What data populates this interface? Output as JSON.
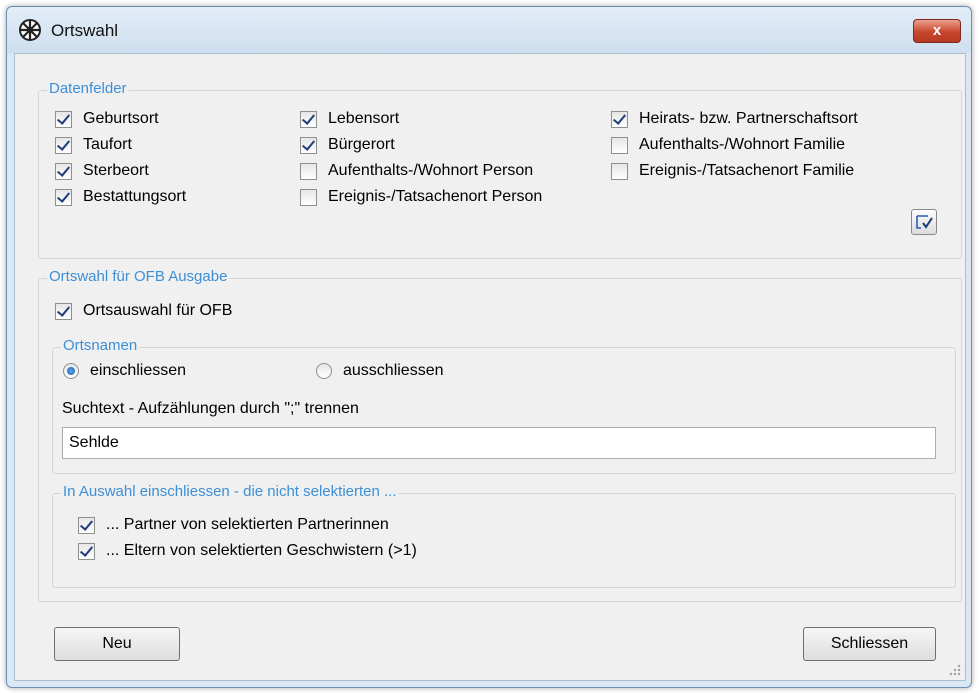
{
  "window": {
    "title": "Ortswahl",
    "close_label": "x"
  },
  "datenfelder": {
    "legend": "Datenfelder",
    "items": [
      {
        "label": "Geburtsort",
        "checked": true
      },
      {
        "label": "Taufort",
        "checked": true
      },
      {
        "label": "Sterbeort",
        "checked": true
      },
      {
        "label": "Bestattungsort",
        "checked": true
      },
      {
        "label": "Lebensort",
        "checked": true
      },
      {
        "label": "Bürgerort",
        "checked": true
      },
      {
        "label": "Aufenthalts-/Wohnort Person",
        "checked": false
      },
      {
        "label": "Ereignis-/Tatsachenort Person",
        "checked": false
      },
      {
        "label": "Heirats- bzw. Partnerschaftsort",
        "checked": true
      },
      {
        "label": "Aufenthalts-/Wohnort Familie",
        "checked": false
      },
      {
        "label": "Ereignis-/Tatsachenort Familie",
        "checked": false
      }
    ]
  },
  "ofb": {
    "legend": "Ortswahl für OFB Ausgabe",
    "ortsauswahl": {
      "label": "Ortsauswahl für OFB",
      "checked": true
    },
    "ortsnamen": {
      "legend": "Ortsnamen",
      "include_label": "einschliessen",
      "exclude_label": "ausschliessen",
      "selected": "einschliessen",
      "search_label": "Suchtext - Aufzählungen durch \";\" trennen",
      "search_value": "Sehlde"
    },
    "einschliessen": {
      "legend": "In Auswahl einschliessen - die nicht selektierten ...",
      "partner": {
        "label": "... Partner von selektierten Partnerinnen",
        "checked": true
      },
      "eltern": {
        "label": "... Eltern von selektierten Geschwistern (>1)",
        "checked": true
      }
    }
  },
  "buttons": {
    "neu": "Neu",
    "schliessen": "Schliessen"
  }
}
